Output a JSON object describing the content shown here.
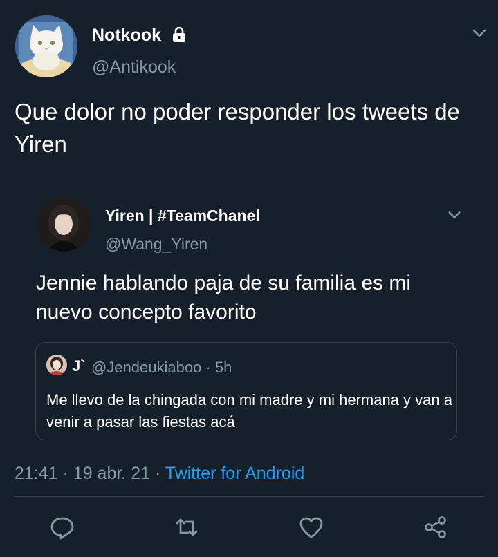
{
  "tweet": {
    "author_name": "Notkook",
    "author_handle": "@Antikook",
    "text": "Que dolor no poder responder los tweets de Yiren",
    "icons": {
      "lock": "lock-icon",
      "menu": "chevron-down-icon"
    }
  },
  "quoted": {
    "author_name": "Yiren | #TeamChanel",
    "author_handle": "@Wang_Yiren",
    "text": "Jennie hablando paja de su familia es mi nuevo concepto favorito",
    "nested": {
      "author_name": "J`",
      "author_handle": "@Jendeukiaboo",
      "time": "5h",
      "text": "Me llevo de la chingada con mi madre y mi hermana y van a venir a pasar las fiestas acá"
    }
  },
  "meta": {
    "time": "21:41",
    "date": "19 abr. 21",
    "source": "Twitter for Android",
    "separator": "·"
  },
  "actions": [
    "reply-icon",
    "retweet-icon",
    "like-icon",
    "share-icon"
  ],
  "colors": {
    "background": "#15202b",
    "text": "#ffffff",
    "secondary_text": "#8899a6",
    "link": "#1da1f2",
    "border": "#38444d"
  }
}
